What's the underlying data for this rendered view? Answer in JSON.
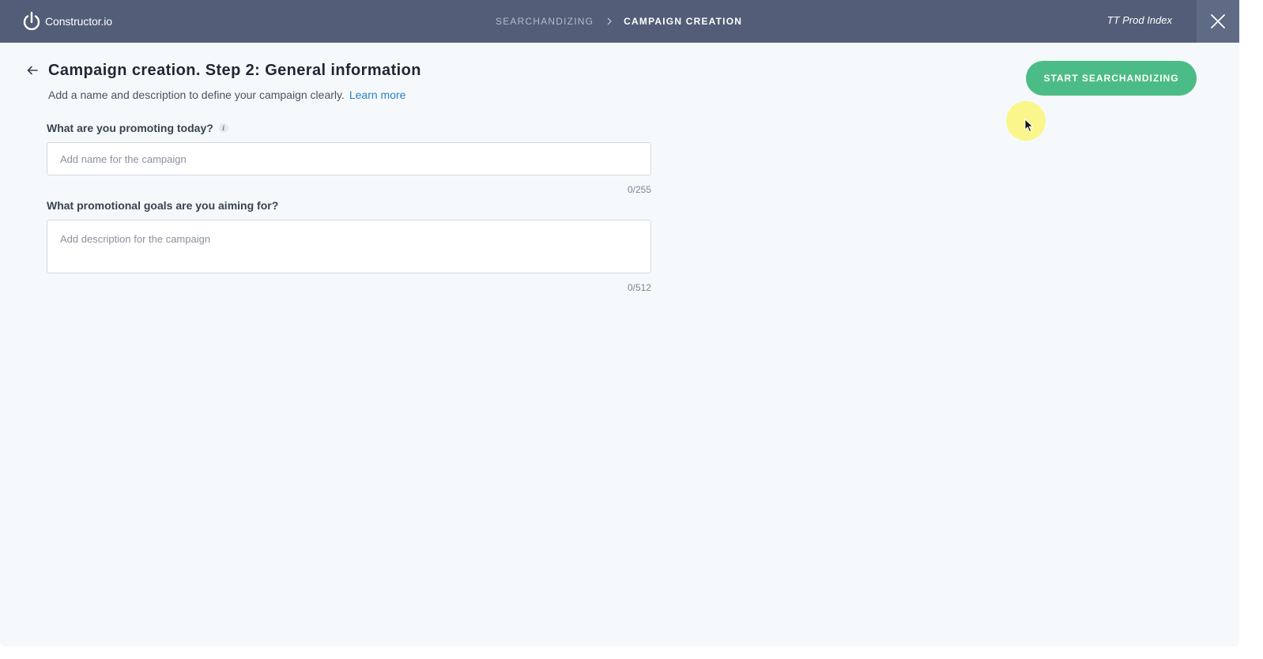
{
  "header": {
    "logo_text": "Constructor.io",
    "breadcrumb": [
      "SEARCHANDIZING",
      "CAMPAIGN CREATION"
    ],
    "index_name": "TT Prod Index"
  },
  "page": {
    "title": "Campaign creation. Step 2: General information",
    "subtitle": "Add a name and description to define your campaign clearly.",
    "learn_more": "Learn more",
    "primary_button": "START SEARCHANDIZING"
  },
  "form": {
    "name": {
      "label": "What are you promoting today?",
      "info": "i",
      "placeholder": "Add name for the campaign",
      "value": "",
      "counter": "0/255"
    },
    "description": {
      "label": "What promotional goals are you aiming for?",
      "placeholder": "Add description for the campaign",
      "value": "",
      "counter": "0/512"
    }
  },
  "colors": {
    "header_bg": "#525d77",
    "page_bg": "#f6f9fb",
    "accent_green": "#4cbc86",
    "link_blue": "#2a7fc6"
  },
  "icons": [
    "constructor-logo-icon",
    "chevron-right-icon",
    "close-icon",
    "arrow-left-icon",
    "info-icon",
    "mouse-cursor-icon"
  ]
}
